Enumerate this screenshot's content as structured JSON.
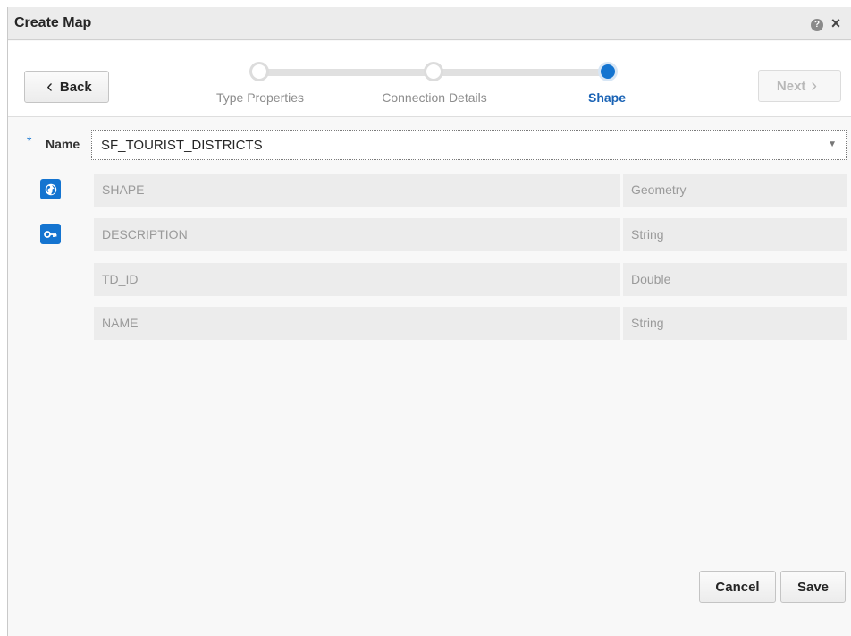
{
  "dialog": {
    "title": "Create Map",
    "help_glyph": "?",
    "close_glyph": "×",
    "icons": [
      "help-icon",
      "close-icon"
    ]
  },
  "wizard": {
    "back_label": "Back",
    "next_label": "Next",
    "back_glyph": "‹",
    "next_glyph": "›",
    "steps": [
      {
        "label": "Type Properties",
        "state": "visited"
      },
      {
        "label": "Connection Details",
        "state": "visited"
      },
      {
        "label": "Shape",
        "state": "current"
      }
    ]
  },
  "form": {
    "required_marker": "*",
    "name_label": "Name",
    "name_value": "SF_TOURIST_DISTRICTS",
    "fields": [
      {
        "name": "SHAPE",
        "type": "Geometry",
        "icon": "globe-icon"
      },
      {
        "name": "DESCRIPTION",
        "type": "String",
        "icon": "key-icon"
      },
      {
        "name": "TD_ID",
        "type": "Double",
        "icon": null
      },
      {
        "name": "NAME",
        "type": "String",
        "icon": null
      }
    ]
  },
  "footer": {
    "cancel_label": "Cancel",
    "save_label": "Save"
  },
  "colors": {
    "accent": "#1474d0",
    "current_step_text": "#1a63b5",
    "field_bg": "#ececec",
    "dialog_bg": "#f8f8f8"
  }
}
